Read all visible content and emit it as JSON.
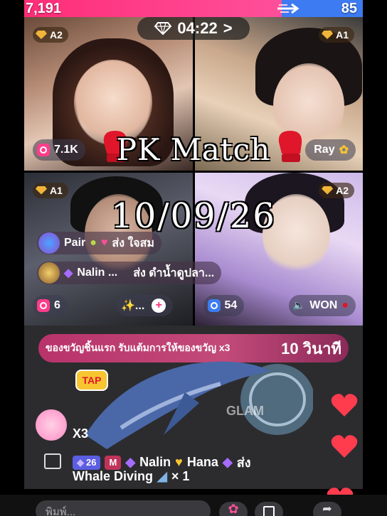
{
  "scores": {
    "left": "7,191",
    "right": "85"
  },
  "colors": {
    "left_team": "#ff2d78",
    "right_team": "#3d7bf2",
    "banner": "#b8336a"
  },
  "timer": {
    "value": "04:22",
    "icon": "diamond-icon",
    "chevron": ">"
  },
  "tiles": [
    {
      "rank": "A2",
      "pill_value": "7.1K",
      "pill_icon": "camera-icon"
    },
    {
      "rank": "A1",
      "pill_value": "Ray",
      "pill_icon": "sunflower-icon"
    },
    {
      "rank": "A1",
      "pill_value": "6",
      "pill_icon": "camera-icon",
      "extra": "✨..."
    },
    {
      "rank": "A2",
      "pill_value": "54",
      "pill_icon": "camera-icon",
      "status": "WON"
    }
  ],
  "overlay": {
    "title": "PK Match",
    "date": "10/09/26"
  },
  "chat": [
    {
      "name": "Pair",
      "text": "ส่ง ใจสม"
    },
    {
      "name": "Nalin ...",
      "text": "ส่ง ดำน้ำดูปลา..."
    }
  ],
  "banner": {
    "text": "ของขวัญชิ้นแรก รับแต้มการให้ของขวัญ x3",
    "countdown": "10 วินาที"
  },
  "tap_label": "TAP",
  "multiplier": "X3",
  "gift_event": {
    "level": "26",
    "badge": "M",
    "sender": "Nalin",
    "receiver": "Hana",
    "verb": "ส่ง",
    "gift_name": "Whale Diving",
    "count": "× 1"
  },
  "watermark": "GLAM",
  "comment_placeholder": "พิมพ์..."
}
